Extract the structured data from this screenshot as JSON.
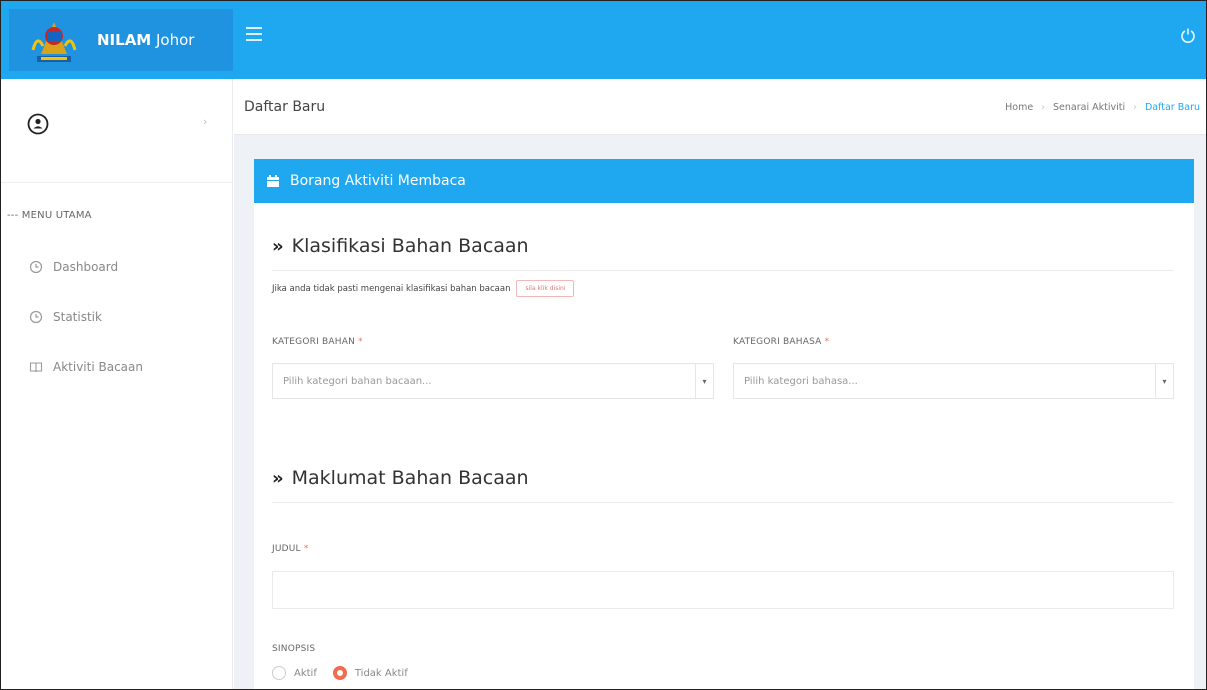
{
  "topbar": {
    "brand_bold": "NILAM",
    "brand_rest": " Johor",
    "colors": {
      "primary": "#1fa8f0",
      "brand_bg": "#1f93e0"
    }
  },
  "sidebar": {
    "menu_title": "--- MENU UTAMA",
    "items": [
      {
        "label": "Dashboard",
        "icon": "clock-icon"
      },
      {
        "label": "Statistik",
        "icon": "clock-icon"
      },
      {
        "label": "Aktiviti Bacaan",
        "icon": "book-icon"
      }
    ]
  },
  "page": {
    "title": "Daftar Baru",
    "breadcrumb": [
      "Home",
      "Senarai Aktiviti",
      "Daftar Baru"
    ]
  },
  "card": {
    "header": "Borang Aktiviti Membaca"
  },
  "section1": {
    "title": "Klasifikasi Bahan Bacaan",
    "hint": "Jika anda tidak pasti mengenai klasifikasi bahan bacaan",
    "hint_button": "sila klik disini",
    "kategori_bahan": {
      "label": "KATEGORI BAHAN",
      "placeholder": "Pilih kategori bahan bacaan..."
    },
    "kategori_bahasa": {
      "label": "KATEGORI BAHASA",
      "placeholder": "Pilih kategori bahasa..."
    }
  },
  "section2": {
    "title": "Maklumat Bahan Bacaan",
    "judul_label": "JUDUL",
    "sinopsis_label": "SINOPSIS",
    "radio_options": [
      "Aktif",
      "Tidak Aktif"
    ],
    "selected": "Tidak Aktif"
  },
  "common": {
    "required_mark": "*"
  }
}
